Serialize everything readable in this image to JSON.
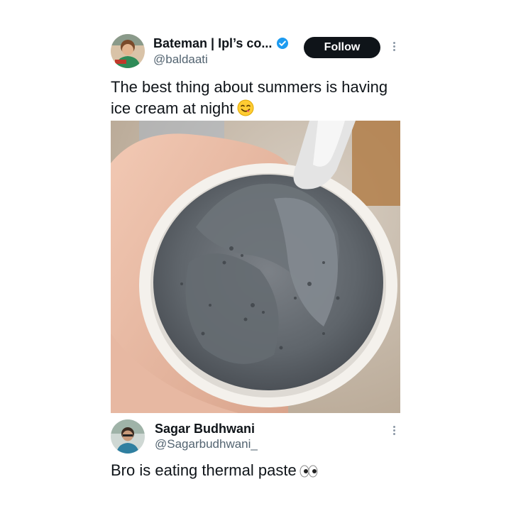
{
  "tweet": {
    "author_name": "Bateman | Ipl’s co...",
    "author_handle": "@baldaati",
    "follow_label": "Follow",
    "text_line1": "The best thing about summers is having",
    "text_line2": "ice cream at night",
    "emoji_icon": "face-savoring-food-icon",
    "image_subject": "grey-ice-cream-cup-photo"
  },
  "reply": {
    "author_name": "Sagar Budhwani",
    "author_handle": "@Sagarbudhwani_",
    "text": "Bro is eating thermal paste",
    "emoji_icon": "eyes-icon"
  },
  "colors": {
    "follow_button_bg": "#0f1419",
    "verified_badge": "#1d9bf0",
    "handle_text": "#536471"
  }
}
